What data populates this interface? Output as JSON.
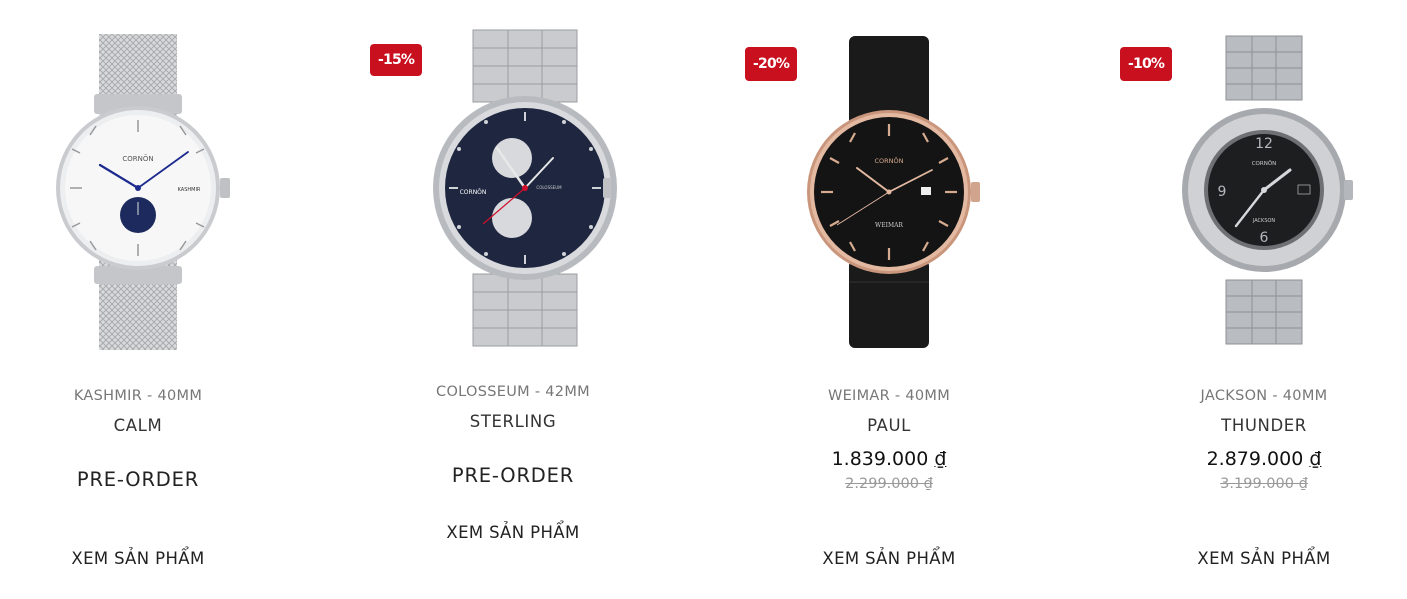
{
  "products": [
    {
      "collection": "KASHMIR - 40MM",
      "name": "CALM",
      "status": "PRE-ORDER",
      "cta": "XEM SẢN PHẨM",
      "image_icon": "watch-silver-mesh-white-dial"
    },
    {
      "badge": "-15%",
      "collection": "COLOSSEUM - 42MM",
      "name": "STERLING",
      "status": "PRE-ORDER",
      "cta": "XEM SẢN PHẨM",
      "image_icon": "watch-steel-link-navy-dial"
    },
    {
      "badge": "-20%",
      "collection": "WEIMAR - 40MM",
      "name": "PAUL",
      "price": "1.839.000",
      "currency": "₫",
      "old_price": "2.299.000 ₫",
      "cta": "XEM SẢN PHẨM",
      "image_icon": "watch-black-leather-rosegold-case"
    },
    {
      "badge": "-10%",
      "collection": "JACKSON - 40MM",
      "name": "THUNDER",
      "price": "2.879.000",
      "currency": "₫",
      "old_price": "3.199.000 ₫",
      "cta": "XEM SẢN PHẨM",
      "image_icon": "watch-steel-bracelet-black-dial"
    }
  ],
  "colors": {
    "badge_bg": "#c8101e",
    "text": "#222222",
    "muted": "#777777",
    "old_price": "#999999"
  }
}
